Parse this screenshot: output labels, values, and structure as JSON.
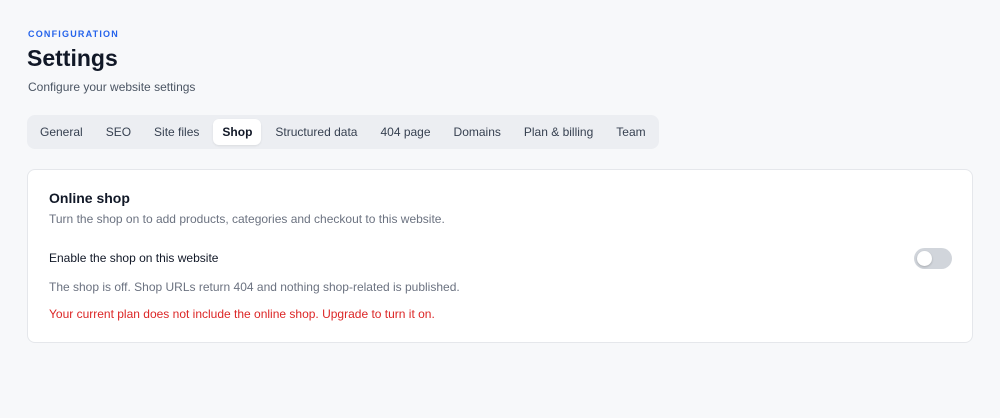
{
  "header": {
    "eyebrow": "CONFIGURATION",
    "title": "Settings",
    "subtitle": "Configure your website settings"
  },
  "tabs": [
    {
      "label": "General",
      "active": false
    },
    {
      "label": "SEO",
      "active": false
    },
    {
      "label": "Site files",
      "active": false
    },
    {
      "label": "Shop",
      "active": true
    },
    {
      "label": "Structured data",
      "active": false
    },
    {
      "label": "404 page",
      "active": false
    },
    {
      "label": "Domains",
      "active": false
    },
    {
      "label": "Plan & billing",
      "active": false
    },
    {
      "label": "Team",
      "active": false
    }
  ],
  "shop_card": {
    "title": "Online shop",
    "description": "Turn the shop on to add products, categories and checkout to this website.",
    "toggle_label": "Enable the shop on this website",
    "toggle_on": false,
    "status": "The shop is off. Shop URLs return 404 and nothing shop-related is published.",
    "warning": "Your current plan does not include the online shop. Upgrade to turn it on."
  },
  "colors": {
    "accent": "#2563eb",
    "warning": "#dc2626",
    "background": "#f7f8fa"
  }
}
